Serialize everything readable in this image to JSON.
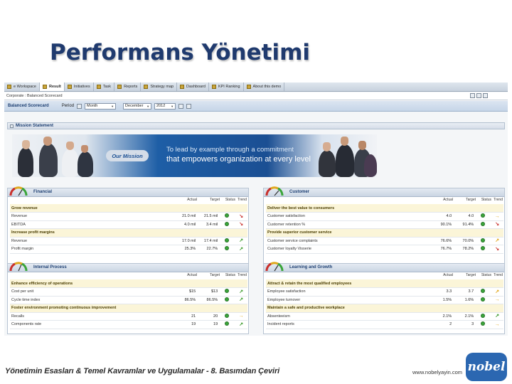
{
  "slide": {
    "title": "Performans Yönetimi"
  },
  "tabs": [
    {
      "label": "e Workspace",
      "active": false
    },
    {
      "label": "Result",
      "active": true
    },
    {
      "label": "Initiatives",
      "active": false
    },
    {
      "label": "Task",
      "active": false
    },
    {
      "label": "Reports",
      "active": false
    },
    {
      "label": "Strategy map",
      "active": false
    },
    {
      "label": "Dashboard",
      "active": false
    },
    {
      "label": "KPI Ranking",
      "active": false
    },
    {
      "label": "About this demo",
      "active": false
    }
  ],
  "breadcrumb": "Corporate : Balanced Scorecard",
  "filters": {
    "scorecard_label": "Balanced Scorecard",
    "period_label": "Period",
    "period_value": "Month",
    "month_value": "December",
    "year_value": "2012"
  },
  "mission": {
    "header": "Mission Statement",
    "badge": "Our Mission",
    "line1": "To lead by example through a commitment",
    "line2": "that empowers organization at every level"
  },
  "panels": {
    "financial": {
      "title": "Financial",
      "columns": [
        "Actual",
        "Target",
        "Status",
        "Trend"
      ],
      "rows": [
        {
          "type": "group",
          "name": "Grow revenue"
        },
        {
          "type": "kpi",
          "name": "Revenue",
          "actual": "21.0 mil",
          "target": "21.5 mil",
          "status": "green",
          "trend": "down"
        },
        {
          "type": "kpi",
          "name": "EBITDA",
          "actual": "4.0 mil",
          "target": "3.4 mil",
          "status": "green",
          "trend": "down"
        },
        {
          "type": "group",
          "name": "Increase profit margins"
        },
        {
          "type": "kpi",
          "name": "Revenue",
          "actual": "17.0 mil",
          "target": "17.4 mil",
          "status": "green",
          "trend": "up"
        },
        {
          "type": "kpi",
          "name": "Profit margin",
          "actual": "25.3%",
          "target": "22.7%",
          "status": "green",
          "trend": "up"
        }
      ]
    },
    "customer": {
      "title": "Customer",
      "columns": [
        "Actual",
        "Target",
        "Status",
        "Trend"
      ],
      "rows": [
        {
          "type": "group",
          "name": "Deliver the best value to consumers"
        },
        {
          "type": "kpi",
          "name": "Customer satisfaction",
          "actual": "4.0",
          "target": "4.0",
          "status": "green",
          "trend": "flat"
        },
        {
          "type": "kpi",
          "name": "Customer retention %",
          "actual": "90.1%",
          "target": "91.4%",
          "status": "green",
          "trend": "down"
        },
        {
          "type": "group",
          "name": "Provide superior customer service"
        },
        {
          "type": "kpi",
          "name": "Customer service complaints",
          "actual": "76.6%",
          "target": "70.0%",
          "status": "green",
          "trend": "right"
        },
        {
          "type": "kpi",
          "name": "Customer loyalty Visserie",
          "actual": "76.7%",
          "target": "78.2%",
          "status": "green",
          "trend": "down"
        }
      ]
    },
    "internal": {
      "title": "Internal Process",
      "columns": [
        "Actual",
        "Target",
        "Status",
        "Trend"
      ],
      "rows": [
        {
          "type": "group",
          "name": "Enhance efficiency of operations"
        },
        {
          "type": "kpi",
          "name": "Cost per unit",
          "actual": "$15",
          "target": "$13",
          "status": "green",
          "trend": "up"
        },
        {
          "type": "kpi",
          "name": "Cycle time index",
          "actual": "86.5%",
          "target": "86.5%",
          "status": "green",
          "trend": "up"
        },
        {
          "type": "group",
          "name": "Foster environment promoting continuous improvement"
        },
        {
          "type": "kpi",
          "name": "Recalls",
          "actual": "21",
          "target": "20",
          "status": "green",
          "trend": "flat"
        },
        {
          "type": "kpi",
          "name": "Components rate",
          "actual": "19",
          "target": "19",
          "status": "green",
          "trend": "up"
        }
      ]
    },
    "learning": {
      "title": "Learning and Growth",
      "columns": [
        "Actual",
        "Target",
        "Status",
        "Trend"
      ],
      "rows": [
        {
          "type": "group",
          "name": "Attract & retain the most qualified employees"
        },
        {
          "type": "kpi",
          "name": "Employee satisfaction",
          "actual": "3.3",
          "target": "3.7",
          "status": "green",
          "trend": "right"
        },
        {
          "type": "kpi",
          "name": "Employee turnover",
          "actual": "1.5%",
          "target": "1.6%",
          "status": "green",
          "trend": "flat"
        },
        {
          "type": "group",
          "name": "Maintain a safe and productive workplace"
        },
        {
          "type": "kpi",
          "name": "Absenteeism",
          "actual": "2.1%",
          "target": "2.1%",
          "status": "green",
          "trend": "up"
        },
        {
          "type": "kpi",
          "name": "Incident reports",
          "actual": "2",
          "target": "3",
          "status": "green",
          "trend": "flat"
        }
      ]
    }
  },
  "footer": {
    "text": "Yönetimin Esasları & Temel Kavramlar ve Uygulamalar - 8. Basımdan Çeviri",
    "url": "www.nobelyayin.com",
    "logo": "nobel"
  },
  "colors": {
    "status_green": "#3aa53a",
    "trend_up": "#3a9a2a",
    "trend_down": "#c9302c",
    "trend_flat": "#e0a81c",
    "title_blue": "#1f3a6e"
  }
}
